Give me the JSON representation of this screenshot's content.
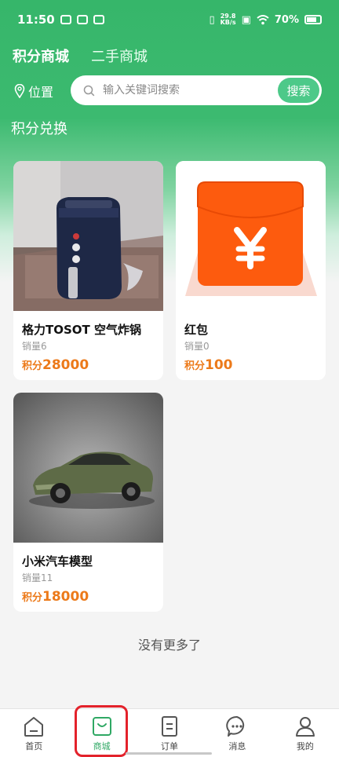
{
  "status_bar": {
    "time": "11:50",
    "net_speed_value": "29.8",
    "net_speed_unit": "KB/s",
    "battery": "70%"
  },
  "header": {
    "tabs": [
      {
        "label": "积分商城",
        "active": true
      },
      {
        "label": "二手商城",
        "active": false
      }
    ],
    "location_label": "位置",
    "search": {
      "placeholder": "输入关键词搜索",
      "value": "",
      "button_label": "搜索"
    },
    "section_title": "积分兑换"
  },
  "products": [
    {
      "name": "格力TOSOT 空气炸锅",
      "sales": "销量6",
      "price_label": "积分",
      "price": "28000",
      "image": "air-fryer-photo"
    },
    {
      "name": "红包",
      "sales": "销量0",
      "price_label": "积分",
      "price": "100",
      "image": "red-envelope-image"
    },
    {
      "name": "小米汽车模型",
      "sales": "销量11",
      "price_label": "积分",
      "price": "18000",
      "image": "car-model-photo"
    }
  ],
  "list_end_text": "没有更多了",
  "tabbar": {
    "items": [
      {
        "label": "首页",
        "icon": "home-icon"
      },
      {
        "label": "商城",
        "icon": "shopping-bag-icon",
        "active": true
      },
      {
        "label": "订单",
        "icon": "order-icon"
      },
      {
        "label": "消息",
        "icon": "message-icon"
      },
      {
        "label": "我的",
        "icon": "profile-icon"
      }
    ]
  },
  "colors": {
    "brand_green": "#36b66a",
    "search_button": "#4dc989",
    "price_orange": "#ec7a1a",
    "highlight_red": "#e3222b"
  }
}
